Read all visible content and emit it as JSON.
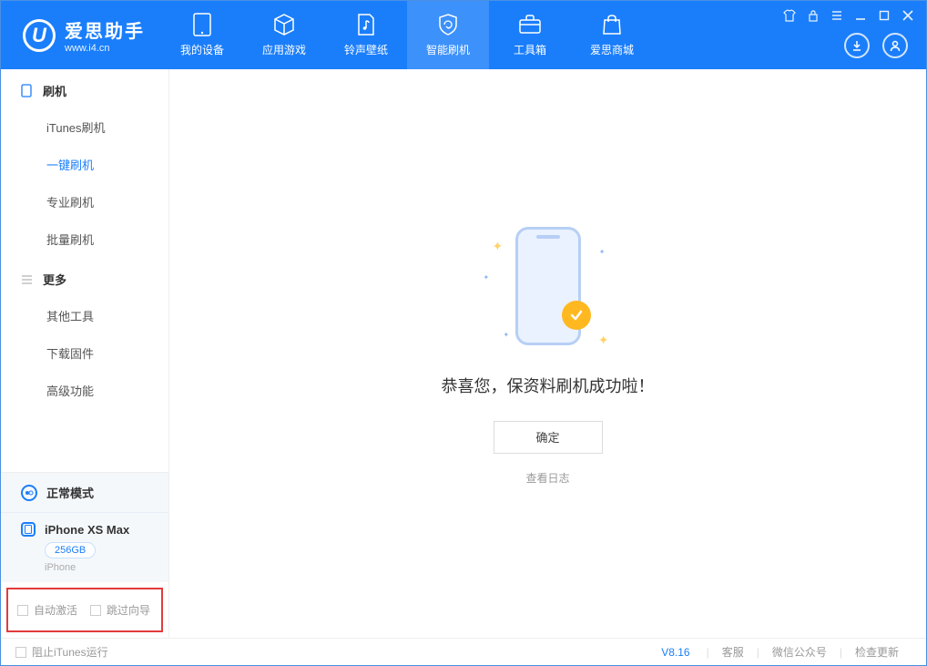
{
  "app": {
    "logo_letter": "U",
    "title": "爱思助手",
    "subtitle": "www.i4.cn"
  },
  "nav": [
    {
      "label": "我的设备",
      "icon": "device"
    },
    {
      "label": "应用游戏",
      "icon": "cube"
    },
    {
      "label": "铃声壁纸",
      "icon": "music"
    },
    {
      "label": "智能刷机",
      "icon": "shield",
      "active": true
    },
    {
      "label": "工具箱",
      "icon": "toolbox"
    },
    {
      "label": "爱思商城",
      "icon": "bag"
    }
  ],
  "sidebar": {
    "section1_title": "刷机",
    "section1_items": [
      {
        "label": "iTunes刷机"
      },
      {
        "label": "一键刷机",
        "active": true
      },
      {
        "label": "专业刷机"
      },
      {
        "label": "批量刷机"
      }
    ],
    "section2_title": "更多",
    "section2_items": [
      {
        "label": "其他工具"
      },
      {
        "label": "下载固件"
      },
      {
        "label": "高级功能"
      }
    ],
    "mode_label": "正常模式",
    "device_name": "iPhone XS Max",
    "device_capacity": "256GB",
    "device_type": "iPhone",
    "checkbox1": "自动激活",
    "checkbox2": "跳过向导"
  },
  "main": {
    "success_text": "恭喜您，保资料刷机成功啦！",
    "ok_button": "确定",
    "log_link": "查看日志"
  },
  "footer": {
    "block_itunes": "阻止iTunes运行",
    "version": "V8.16",
    "link1": "客服",
    "link2": "微信公众号",
    "link3": "检查更新"
  }
}
